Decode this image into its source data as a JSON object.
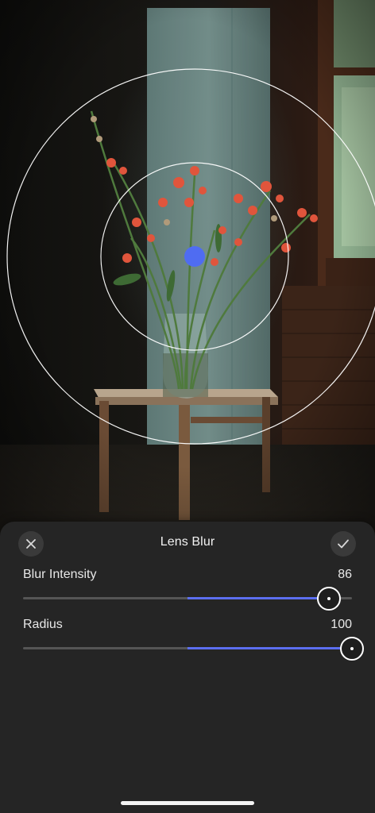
{
  "photo": {
    "subject": "red-flowers-in-vase-on-stool",
    "focus_point_color": "#4f6cf2"
  },
  "sheet": {
    "title": "Lens Blur",
    "close_icon": "close-icon",
    "done_icon": "checkmark-icon"
  },
  "params": {
    "intensity": {
      "label": "Blur Intensity",
      "value": "86",
      "fill_start": 0.5,
      "level": 0.93
    },
    "radius": {
      "label": "Radius",
      "value": "100",
      "fill_start": 0.5,
      "level": 1.0
    }
  },
  "colors": {
    "accent": "#5b6ef0",
    "sheet_bg": "#252525",
    "track": "#555555"
  }
}
